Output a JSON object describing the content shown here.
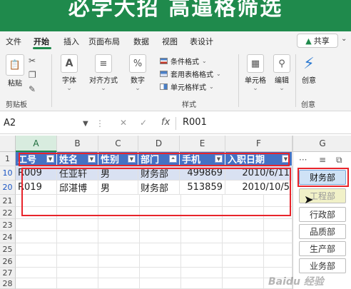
{
  "banner": {
    "text": "必学大招 高逼格筛选"
  },
  "ribbon": {
    "tabs": [
      "文件",
      "开始",
      "插入",
      "页面布局",
      "数据",
      "视图",
      "表设计"
    ],
    "active_tab": "开始",
    "share_label": "共享",
    "paste_label": "粘贴",
    "font_label": "字体",
    "align_label": "对齐方式",
    "number_label": "数字",
    "cond_format_label": "条件格式",
    "table_format_label": "套用表格格式",
    "cell_style_label": "单元格样式",
    "cells_label": "单元格",
    "edit_label": "编辑",
    "idea_label": "创意",
    "clipboard_group": "剪贴板",
    "style_group": "样式",
    "idea_group": "创意"
  },
  "formula_bar": {
    "name_box": "A2",
    "fx": "fx",
    "value": "R001"
  },
  "grid": {
    "columns": [
      "A",
      "B",
      "C",
      "D",
      "E",
      "F",
      "G"
    ],
    "row_numbers": [
      "1",
      "10",
      "20",
      "21",
      "22",
      "23",
      "24",
      "25",
      "26",
      "27",
      "28",
      "29"
    ],
    "headers": [
      "工号",
      "姓名",
      "性别",
      "部门",
      "手机",
      "入职日期"
    ],
    "rows": [
      [
        "R009",
        "任亚轩",
        "男",
        "财务部",
        "499869",
        "2010/6/11"
      ],
      [
        "R019",
        "邱湛博",
        "男",
        "财务部",
        "513859",
        "2010/10/5"
      ]
    ]
  },
  "slicer": {
    "dots": "···",
    "items": [
      "财务部",
      "工程部",
      "行政部",
      "品质部",
      "生产部",
      "业务部"
    ],
    "selected": "财务部"
  },
  "watermark": "Baidu 经验",
  "colors": {
    "banner": "#1f8a4c",
    "table_header": "#4472c4",
    "table_band": "#d9e1f2",
    "highlight_box": "#e8242b",
    "slicer_selected": "#cfe2f6"
  },
  "icons": [
    "paste-icon",
    "cut-icon",
    "copy-icon",
    "format-painter-icon",
    "font-icon",
    "align-icon",
    "percent-icon",
    "cells-icon",
    "search-icon",
    "lightning-icon",
    "multiselect-icon",
    "clear-filter-icon",
    "share-icon"
  ]
}
